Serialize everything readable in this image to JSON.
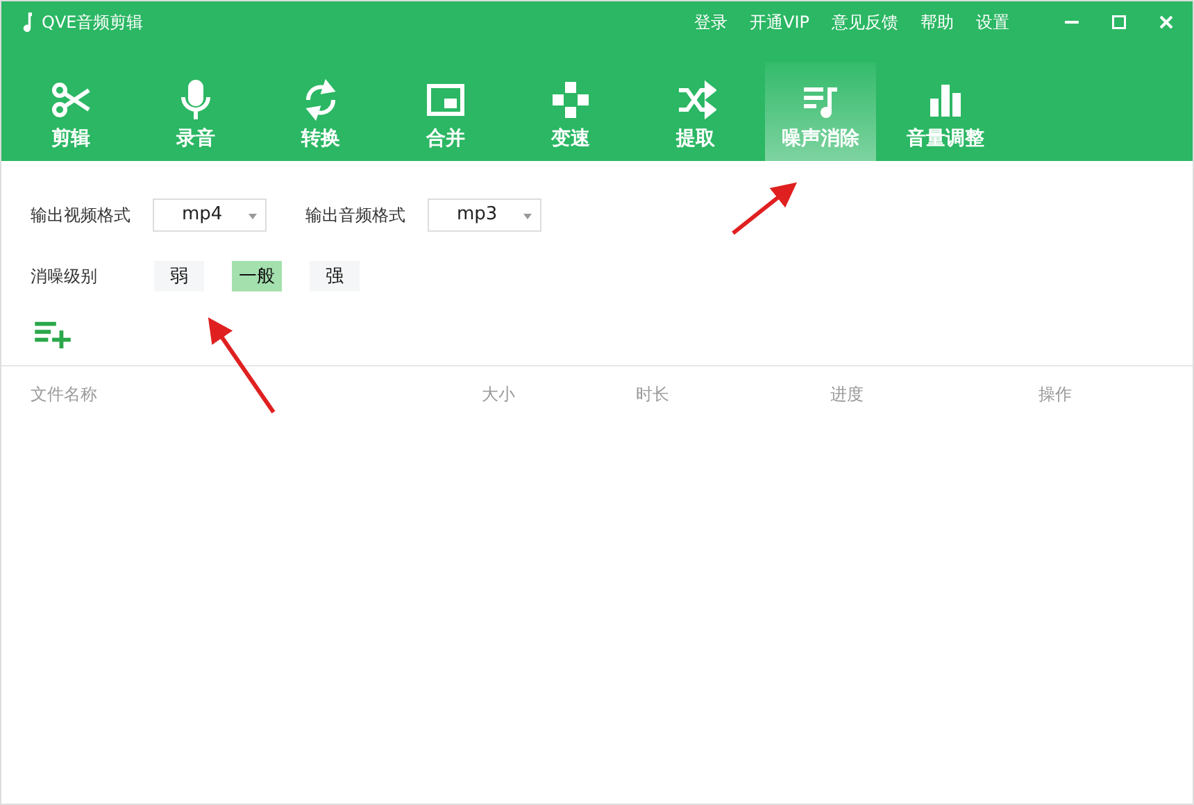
{
  "window": {
    "title": "QVE音频剪辑"
  },
  "top_links": [
    "登录",
    "开通VIP",
    "意见反馈",
    "帮助",
    "设置"
  ],
  "tabs": [
    {
      "label": "剪辑",
      "selected": false
    },
    {
      "label": "录音",
      "selected": false
    },
    {
      "label": "转换",
      "selected": false
    },
    {
      "label": "合并",
      "selected": false
    },
    {
      "label": "变速",
      "selected": false
    },
    {
      "label": "提取",
      "selected": false
    },
    {
      "label": "噪声消除",
      "selected": true
    },
    {
      "label": "音量调整",
      "selected": false
    }
  ],
  "formats": [
    {
      "label": "输出视频格式",
      "value": "mp4"
    },
    {
      "label": "输出音频格式",
      "value": "mp3"
    }
  ],
  "noise_level": {
    "label": "消噪级别",
    "options": [
      {
        "label": "弱",
        "selected": false
      },
      {
        "label": "一般",
        "selected": true
      },
      {
        "label": "强",
        "selected": false
      }
    ]
  },
  "table": {
    "columns": [
      "文件名称",
      "大小",
      "时长",
      "进度",
      "操作"
    ]
  }
}
